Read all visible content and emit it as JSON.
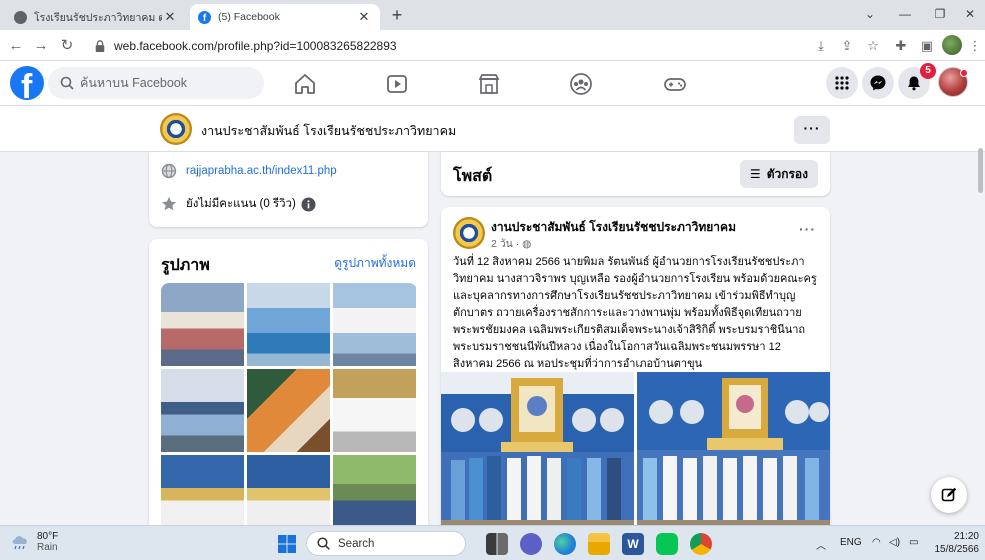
{
  "browser": {
    "tabs": [
      {
        "title": "โรงเรียนรัชประภาวิทยาคม ต.เขาพัง อ.",
        "active": false
      },
      {
        "title": "(5) Facebook",
        "active": true
      }
    ],
    "url": "web.facebook.com/profile.php?id=100083265822893"
  },
  "facebook": {
    "search_placeholder": "ค้นหาบน Facebook",
    "notification_count": "5"
  },
  "page": {
    "name": "งานประชาสัมพันธ์ โรงเรียนรัชชประภาวิทยาคม",
    "more_label": "···"
  },
  "intro": {
    "website": "rajjaprabha.ac.th/index11.php",
    "rating": "ยังไม่มีคะแนน (0 รีวิว)"
  },
  "photos": {
    "heading": "รูปภาพ",
    "see_all": "ดูรูปภาพทั้งหมด"
  },
  "posts": {
    "heading": "โพสต์",
    "filter_label": "ตัวกรอง"
  },
  "post": {
    "author": "งานประชาสัมพันธ์ โรงเรียนรัชชประภาวิทยาคม",
    "time": "2 วัน",
    "more_label": "···",
    "text": "วันที่ 12 สิงหาคม 2566 นายพิมล รัตนพันธ์ ผู้อำนวยการโรงเรียนรัชชประภาวิทยาคม นางสาวจิราพร บุญเหลือ รองผู้อำนวยการโรงเรียน พร้อมด้วยคณะครูและบุคลากรทางการศึกษาโรงเรียนรัชชประภาวิทยาคม เข้าร่วมพิธีทำบุญตักบาตร ถวายเครื่องราชสักการะและวางพานพุ่ม พร้อมทั้งพิธีจุดเทียนถวายพระพรชัยมงคล เฉลิมพระเกียรติสมเด็จพระนางเจ้าสิริกิติ์ พระบรมราชินีนาถ พระบรมราชชนนีพันปีหลวง เนื่องในโอกาสวันเฉลิมพระชนมพรรษา 12 สิงหาคม 2566 ณ หอประชุมที่ว่าการอำเภอบ้านตาขุน"
  },
  "taskbar": {
    "temperature": "80°F",
    "condition": "Rain",
    "search_label": "Search",
    "language": "ENG",
    "time": "21:20",
    "date": "15/8/2566"
  },
  "colors": {
    "facebook_blue": "#1877f2",
    "link": "#216fdb",
    "badge_red": "#e41e3f"
  }
}
